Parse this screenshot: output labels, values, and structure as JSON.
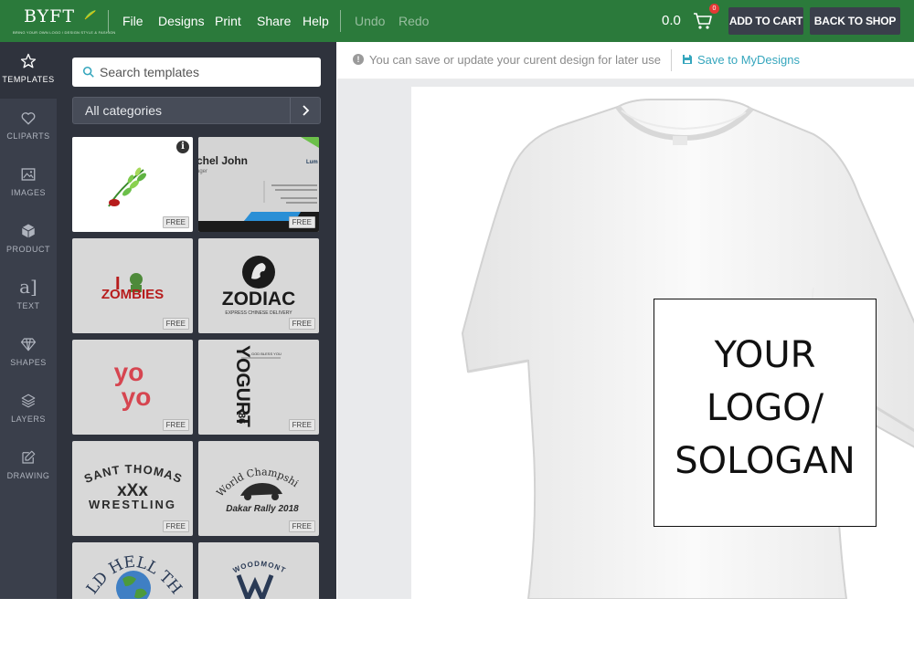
{
  "brand": {
    "name": "BYFT",
    "tagline": "BRING YOUR OWN LOGO / DESIGN STYLE & FASHION"
  },
  "menu": [
    "File",
    "Designs",
    "Print",
    "Share",
    "Help"
  ],
  "history": {
    "undo": "Undo",
    "redo": "Redo"
  },
  "cart": {
    "price": "0.0",
    "count": "0"
  },
  "buttons": {
    "add_to_cart": "ADD TO CART",
    "back_to_shop": "BACK TO SHOP"
  },
  "rail": [
    {
      "label": "TEMPLATES",
      "icon": "star-icon"
    },
    {
      "label": "CLIPARTS",
      "icon": "heart-icon"
    },
    {
      "label": "IMAGES",
      "icon": "image-icon"
    },
    {
      "label": "PRODUCT",
      "icon": "box-icon"
    },
    {
      "label": "TEXT",
      "icon": "text-icon"
    },
    {
      "label": "SHAPES",
      "icon": "diamond-icon"
    },
    {
      "label": "LAYERS",
      "icon": "layers-icon"
    },
    {
      "label": "DRAWING",
      "icon": "edit-icon"
    }
  ],
  "search": {
    "placeholder": "Search templates"
  },
  "category": {
    "selected": "All categories"
  },
  "templates": {
    "badge": "FREE",
    "card_name": "chel John",
    "card_role": "ager",
    "card_brand": "Lum",
    "zombies_i": "I",
    "zombies": "ZOMBIES",
    "zodiac": "ZODIAC",
    "zodiac_sub": "EXPRESS CHINESE DELIVERY",
    "yo1": "yo",
    "yo2": "yo",
    "yogurt": "YOGURT",
    "yogurt_num": "86",
    "yogurt_small": "GOD BLESS YOU",
    "sant": "SANT THOMAS",
    "xxx": "xXx",
    "wrestling": "WRESTLING",
    "champ": "World Champship",
    "rally": "Dakar Rally 2018",
    "hell": "LD HELL TH",
    "woodmont": "WOODMONT"
  },
  "notice": {
    "text": "You can save or update your curent design for later use",
    "save_label": "Save to MyDesigns"
  },
  "design": {
    "lines": [
      "YOUR",
      "LOGO/",
      "SOLOGAN"
    ]
  },
  "colors": {
    "topbar": "#2b7a3b",
    "rail": "#3a3f4b",
    "panel": "#2f333d",
    "accent": "#35a6bd"
  }
}
